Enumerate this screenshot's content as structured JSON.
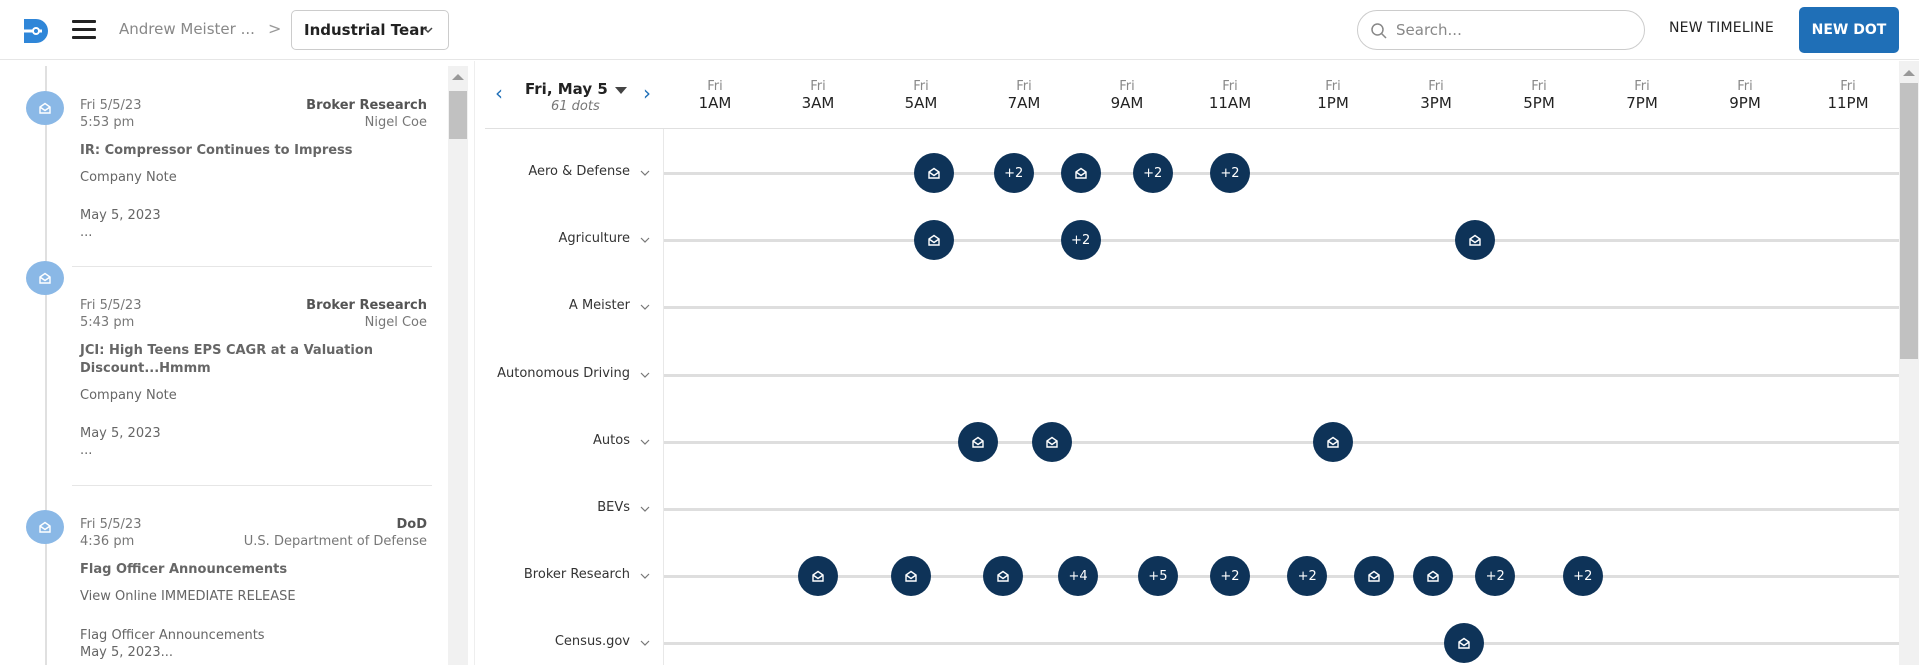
{
  "header": {
    "breadcrumb": "Andrew Meister ...",
    "breadcrumb_separator": ">",
    "timeline_select": "Industrial Tear",
    "search_placeholder": "Search...",
    "new_timeline_label": "NEW TIMELINE",
    "new_dot_label": "NEW DOT",
    "brand_color": "#1f6fb7"
  },
  "feed": {
    "items": [
      {
        "date": "Fri 5/5/23",
        "time": "5:53 pm",
        "source": "Broker Research",
        "author": "Nigel Coe",
        "title": "IR: Compressor Continues to Impress",
        "type": "Company Note",
        "body_line1": "May 5, 2023",
        "body_line2": "..."
      },
      {
        "date": "Fri 5/5/23",
        "time": "5:43 pm",
        "source": "Broker Research",
        "author": "Nigel Coe",
        "title": "JCI: High Teens EPS CAGR at a Valuation Discount...Hmmm",
        "type": "Company Note",
        "body_line1": "May 5, 2023",
        "body_line2": "..."
      },
      {
        "date": "Fri 5/5/23",
        "time": "4:36 pm",
        "source": "DoD",
        "author": "U.S. Department of Defense",
        "title": "Flag Officer Announcements",
        "type": "View Online IMMEDIATE RELEASE",
        "body_line1": "Flag Officer Announcements",
        "body_line2": "May 5, 2023..."
      }
    ]
  },
  "timeline": {
    "day_label": "Fri, May 5",
    "dot_count": "61 dots",
    "dot_color": "#0e3358",
    "ticks": [
      {
        "day": "Fri",
        "time": "1AM",
        "hour": 1
      },
      {
        "day": "Fri",
        "time": "3AM",
        "hour": 3
      },
      {
        "day": "Fri",
        "time": "5AM",
        "hour": 5
      },
      {
        "day": "Fri",
        "time": "7AM",
        "hour": 7
      },
      {
        "day": "Fri",
        "time": "9AM",
        "hour": 9
      },
      {
        "day": "Fri",
        "time": "11AM",
        "hour": 11
      },
      {
        "day": "Fri",
        "time": "1PM",
        "hour": 13
      },
      {
        "day": "Fri",
        "time": "3PM",
        "hour": 15
      },
      {
        "day": "Fri",
        "time": "5PM",
        "hour": 17
      },
      {
        "day": "Fri",
        "time": "7PM",
        "hour": 19
      },
      {
        "day": "Fri",
        "time": "9PM",
        "hour": 21
      },
      {
        "day": "Fri",
        "time": "11PM",
        "hour": 23
      }
    ],
    "rows": [
      {
        "label": "Aero & Defense",
        "dots": [
          {
            "hour": 5.25,
            "label": ""
          },
          {
            "hour": 6.8,
            "label": "+2"
          },
          {
            "hour": 8.1,
            "label": ""
          },
          {
            "hour": 9.5,
            "label": "+2"
          },
          {
            "hour": 11.0,
            "label": "+2"
          }
        ]
      },
      {
        "label": "Agriculture",
        "dots": [
          {
            "hour": 5.25,
            "label": ""
          },
          {
            "hour": 8.1,
            "label": "+2"
          },
          {
            "hour": 15.75,
            "label": ""
          }
        ]
      },
      {
        "label": "A Meister",
        "dots": []
      },
      {
        "label": "Autonomous Driving",
        "dots": []
      },
      {
        "label": "Autos",
        "dots": [
          {
            "hour": 6.1,
            "label": ""
          },
          {
            "hour": 7.55,
            "label": ""
          },
          {
            "hour": 13.0,
            "label": ""
          }
        ]
      },
      {
        "label": "BEVs",
        "dots": []
      },
      {
        "label": "Broker Research",
        "dots": [
          {
            "hour": 3.0,
            "label": ""
          },
          {
            "hour": 4.8,
            "label": ""
          },
          {
            "hour": 6.6,
            "label": ""
          },
          {
            "hour": 8.05,
            "label": "+4"
          },
          {
            "hour": 9.6,
            "label": "+5"
          },
          {
            "hour": 11.0,
            "label": "+2"
          },
          {
            "hour": 12.5,
            "label": "+2"
          },
          {
            "hour": 13.8,
            "label": ""
          },
          {
            "hour": 14.95,
            "label": ""
          },
          {
            "hour": 16.15,
            "label": "+2"
          },
          {
            "hour": 17.85,
            "label": "+2"
          }
        ]
      },
      {
        "label": "Census.gov",
        "dots": [
          {
            "hour": 15.55,
            "label": ""
          }
        ]
      }
    ]
  }
}
